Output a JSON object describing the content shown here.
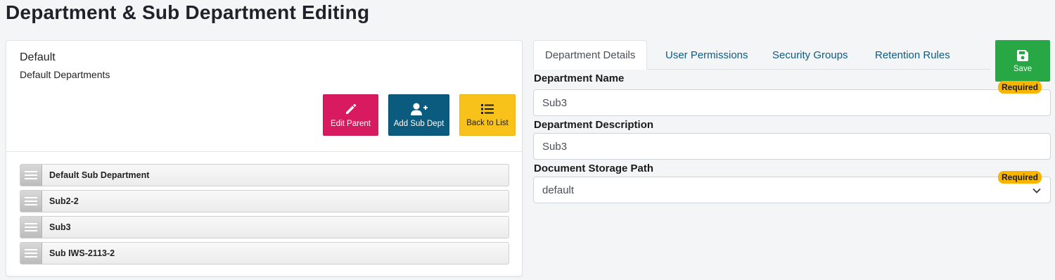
{
  "page": {
    "title": "Department & Sub Department Editing"
  },
  "department": {
    "name": "Default",
    "subtitle": "Default Departments"
  },
  "actions": {
    "edit_parent": "Edit Parent",
    "add_sub_dept": "Add Sub Dept",
    "back_to_list": "Back to List"
  },
  "sub_departments": [
    {
      "label": "Default Sub Department"
    },
    {
      "label": "Sub2-2"
    },
    {
      "label": "Sub3"
    },
    {
      "label": "Sub IWS-2113-2"
    }
  ],
  "tabs": [
    {
      "label": "Department Details",
      "active": true
    },
    {
      "label": "User Permissions",
      "active": false
    },
    {
      "label": "Security Groups",
      "active": false
    },
    {
      "label": "Retention Rules",
      "active": false
    }
  ],
  "save_label": "Save",
  "form": {
    "name_label": "Department Name",
    "name_value": "Sub3",
    "name_badge": "Required",
    "description_label": "Department Description",
    "description_value": "Sub3",
    "storage_label": "Document Storage Path",
    "storage_value": "default",
    "storage_badge": "Required"
  },
  "colors": {
    "edit_parent": "#d81b60",
    "add_sub_dept": "#0b5b7f",
    "back_to_list": "#f9c21a",
    "save": "#28a745",
    "required_badge": "#f7b500",
    "tab_link": "#0d5c82"
  },
  "icons": {
    "edit_parent": "pencil-icon",
    "add_sub_dept": "user-plus-icon",
    "back_to_list": "list-icon",
    "save": "floppy-disk-icon",
    "drag_handle": "drag-handle-icon",
    "select": "chevron-down-icon"
  }
}
